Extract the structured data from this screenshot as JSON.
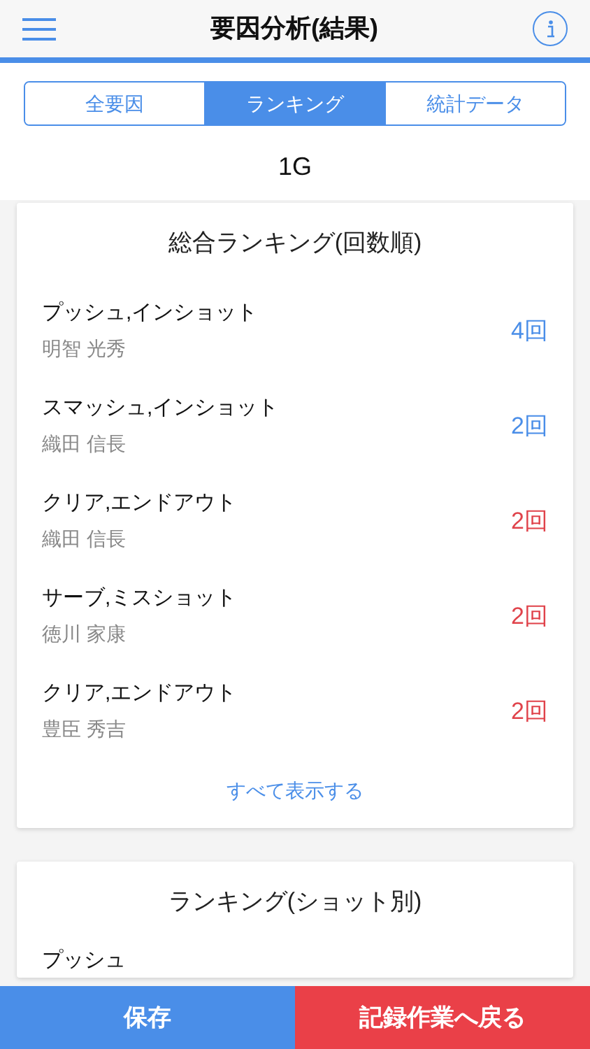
{
  "header": {
    "title": "要因分析(結果)"
  },
  "tabs": [
    {
      "label": "全要因",
      "selected": false
    },
    {
      "label": "ランキング",
      "selected": true
    },
    {
      "label": "統計データ",
      "selected": false
    }
  ],
  "game": "1G",
  "overall_ranking": {
    "title": "総合ランキング(回数順)",
    "rows": [
      {
        "shot": "プッシュ,インショット",
        "player": "明智 光秀",
        "count": "4回",
        "color": "#4a8ee8"
      },
      {
        "shot": "スマッシュ,インショット",
        "player": "織田 信長",
        "count": "2回",
        "color": "#4a8ee8"
      },
      {
        "shot": "クリア,エンドアウト",
        "player": "織田 信長",
        "count": "2回",
        "color": "#e0434b"
      },
      {
        "shot": "サーブ,ミスショット",
        "player": "徳川 家康",
        "count": "2回",
        "color": "#e0434b"
      },
      {
        "shot": "クリア,エンドアウト",
        "player": "豊臣 秀吉",
        "count": "2回",
        "color": "#e0434b"
      }
    ],
    "show_all": "すべて表示する"
  },
  "shot_ranking": {
    "title": "ランキング(ショット別)",
    "rows": [
      {
        "shot": "プッシュ"
      }
    ]
  },
  "footer": {
    "save": "保存",
    "back": "記録作業へ戻る"
  }
}
